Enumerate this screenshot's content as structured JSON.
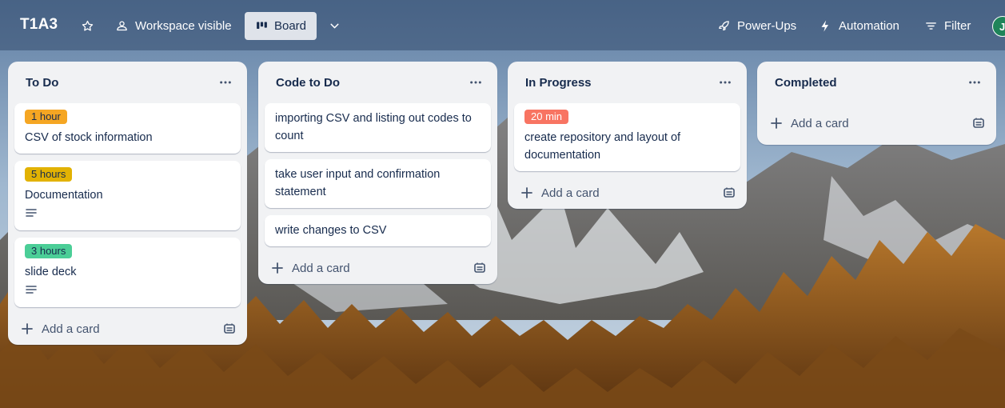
{
  "board": {
    "title": "T1A3",
    "visibility": "Workspace visible",
    "view": "Board"
  },
  "header_actions": {
    "power_ups": "Power-Ups",
    "automation": "Automation",
    "filter": "Filter",
    "avatar_initial": "J"
  },
  "colors": {
    "label_orange": "#f5a623",
    "label_yellow": "#e2b203",
    "label_green": "#4bce97",
    "label_red": "#f87462",
    "avatar_green": "#1f845a"
  },
  "lists": [
    {
      "title": "To Do",
      "cards": [
        {
          "label": "1 hour",
          "text": "CSV of stock information"
        },
        {
          "label": "5 hours",
          "text": "Documentation"
        },
        {
          "label": "3 hours",
          "text": "slide deck"
        }
      ],
      "add_label": "Add a card"
    },
    {
      "title": "Code to Do",
      "cards": [
        {
          "text": "importing CSV and listing out codes to count"
        },
        {
          "text": "take user input and confirmation statement"
        },
        {
          "text": "write changes to CSV"
        }
      ],
      "add_label": "Add a card"
    },
    {
      "title": "In Progress",
      "cards": [
        {
          "label": "20 min",
          "text": "create repository and layout of documentation"
        }
      ],
      "add_label": "Add a card"
    },
    {
      "title": "Completed",
      "cards": [],
      "add_label": "Add a card"
    }
  ]
}
